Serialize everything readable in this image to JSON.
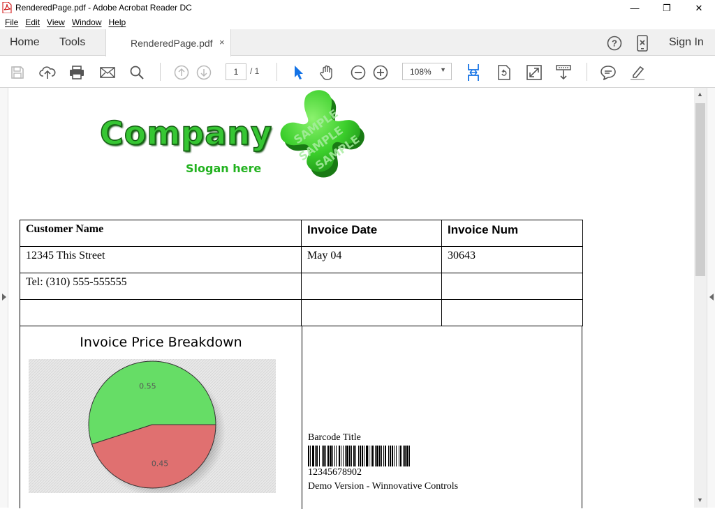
{
  "window": {
    "title": "RenderedPage.pdf - Adobe Acrobat Reader DC",
    "minimize": "—",
    "restore": "❐",
    "close": "✕"
  },
  "menu": [
    "File",
    "Edit",
    "View",
    "Window",
    "Help"
  ],
  "tabs": {
    "home": "Home",
    "tools": "Tools",
    "document": "RenderedPage.pdf",
    "close": "×",
    "sign_in": "Sign In"
  },
  "toolbar": {
    "page_current": "1",
    "page_total": "/ 1",
    "zoom": "108%",
    "accent": "#1473e6"
  },
  "document": {
    "logo_text": "Company",
    "slogan": "Slogan here",
    "table": {
      "headers": [
        "Customer Name",
        "Invoice Date",
        "Invoice Num"
      ],
      "rows": [
        [
          "12345 This Street",
          "May 04",
          "30643"
        ],
        [
          "Tel: (310) 555-555555",
          "",
          ""
        ],
        [
          "",
          "",
          ""
        ]
      ]
    },
    "chart_title": "Invoice Price Breakdown",
    "barcode": {
      "title": "Barcode Title",
      "number": "12345678902",
      "footer": "Demo Version - Winnovative Controls"
    }
  },
  "chart_data": {
    "type": "pie",
    "title": "Invoice Price Breakdown",
    "values": [
      0.55,
      0.45
    ],
    "labels": [
      "0.55",
      "0.45"
    ],
    "colors": [
      "#66dd66",
      "#e07070"
    ]
  }
}
